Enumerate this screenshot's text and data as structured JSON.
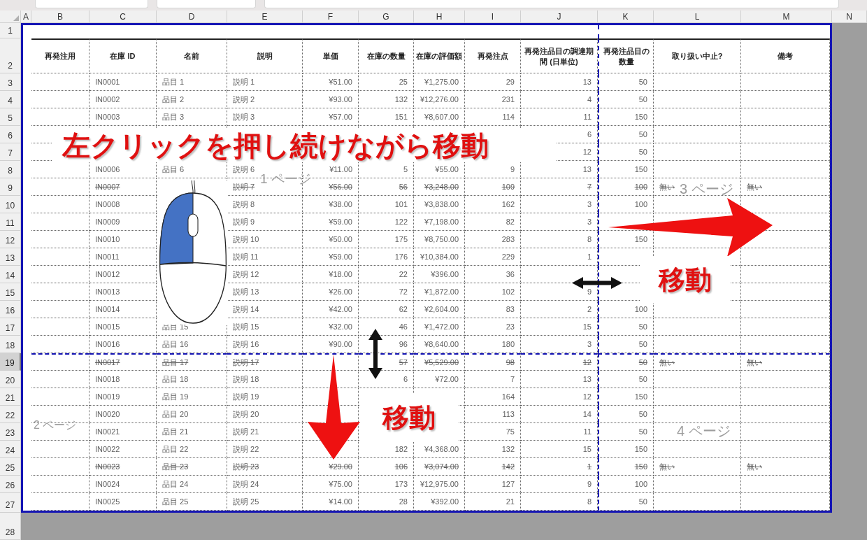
{
  "column_headers": [
    "A",
    "B",
    "C",
    "D",
    "E",
    "F",
    "G",
    "H",
    "I",
    "J",
    "K",
    "L",
    "M",
    "N"
  ],
  "row_numbers": [
    {
      "label": "1",
      "selected": false
    },
    {
      "label": "2",
      "selected": false
    },
    {
      "label": "3",
      "selected": false
    },
    {
      "label": "4",
      "selected": false
    },
    {
      "label": "5",
      "selected": false
    },
    {
      "label": "6",
      "selected": false
    },
    {
      "label": "7",
      "selected": false
    },
    {
      "label": "8",
      "selected": false
    },
    {
      "label": "9",
      "selected": false
    },
    {
      "label": "10",
      "selected": false
    },
    {
      "label": "11",
      "selected": false
    },
    {
      "label": "12",
      "selected": false
    },
    {
      "label": "13",
      "selected": false
    },
    {
      "label": "14",
      "selected": false
    },
    {
      "label": "15",
      "selected": false
    },
    {
      "label": "16",
      "selected": false
    },
    {
      "label": "17",
      "selected": false
    },
    {
      "label": "18",
      "selected": false
    },
    {
      "label": "19",
      "selected": true
    },
    {
      "label": "20",
      "selected": false
    },
    {
      "label": "21",
      "selected": false
    },
    {
      "label": "22",
      "selected": false
    },
    {
      "label": "23",
      "selected": false
    },
    {
      "label": "24",
      "selected": false
    },
    {
      "label": "25",
      "selected": false
    },
    {
      "label": "26",
      "selected": false
    },
    {
      "label": "27",
      "selected": false
    },
    {
      "label": "28",
      "selected": false
    }
  ],
  "table": {
    "columns": [
      "再発注用",
      "在庫 ID",
      "名前",
      "説明",
      "単価",
      "在庫の数量",
      "在庫の評価額",
      "再発注点",
      "再発注品目の調達期間 (日単位)",
      "再発注品目の数量",
      "取り扱い中止?",
      "備考"
    ],
    "rows": [
      {
        "discontinued": false,
        "cells": [
          null,
          "IN0001",
          "品目 1",
          "説明 1",
          "¥51.00",
          "25",
          "¥1,275.00",
          "29",
          "13",
          "50",
          null,
          null
        ]
      },
      {
        "discontinued": false,
        "cells": [
          null,
          "IN0002",
          "品目 2",
          "説明 2",
          "¥93.00",
          "132",
          "¥12,276.00",
          "231",
          "4",
          "50",
          null,
          null
        ]
      },
      {
        "discontinued": false,
        "cells": [
          null,
          "IN0003",
          "品目 3",
          "説明 3",
          "¥57.00",
          "151",
          "¥8,607.00",
          "114",
          "11",
          "150",
          null,
          null
        ]
      },
      {
        "discontinued": false,
        "cells": [
          null,
          null,
          null,
          null,
          null,
          null,
          null,
          null,
          "6",
          "50",
          null,
          null
        ]
      },
      {
        "discontinued": false,
        "cells": [
          null,
          null,
          null,
          null,
          null,
          null,
          null,
          null,
          "12",
          "50",
          null,
          null
        ]
      },
      {
        "discontinued": false,
        "cells": [
          null,
          "IN0006",
          "品目 6",
          "説明 6",
          "¥11.00",
          "5",
          "¥55.00",
          "9",
          "13",
          "150",
          null,
          null
        ]
      },
      {
        "discontinued": true,
        "cells": [
          null,
          "IN0007",
          null,
          "説明 7",
          "¥56.00",
          "56",
          "¥3,248.00",
          "109",
          "7",
          "100",
          "無い",
          "無い"
        ]
      },
      {
        "discontinued": false,
        "cells": [
          null,
          "IN0008",
          null,
          "説明 8",
          "¥38.00",
          "101",
          "¥3,838.00",
          "162",
          "3",
          "100",
          null,
          null
        ]
      },
      {
        "discontinued": false,
        "cells": [
          null,
          "IN0009",
          null,
          "説明 9",
          "¥59.00",
          "122",
          "¥7,198.00",
          "82",
          "3",
          null,
          null,
          null
        ]
      },
      {
        "discontinued": false,
        "cells": [
          null,
          "IN0010",
          null,
          "説明 10",
          "¥50.00",
          "175",
          "¥8,750.00",
          "283",
          "8",
          "150",
          null,
          null
        ]
      },
      {
        "discontinued": false,
        "cells": [
          null,
          "IN0011",
          null,
          "説明 11",
          "¥59.00",
          "176",
          "¥10,384.00",
          "229",
          "1",
          null,
          null,
          null
        ]
      },
      {
        "discontinued": false,
        "cells": [
          null,
          "IN0012",
          null,
          "説明 12",
          "¥18.00",
          "22",
          "¥396.00",
          "36",
          null,
          null,
          null,
          null
        ]
      },
      {
        "discontinued": false,
        "cells": [
          null,
          "IN0013",
          null,
          "説明 13",
          "¥26.00",
          "72",
          "¥1,872.00",
          "102",
          "9",
          null,
          null,
          null
        ]
      },
      {
        "discontinued": false,
        "cells": [
          null,
          "IN0014",
          null,
          "説明 14",
          "¥42.00",
          "62",
          "¥2,604.00",
          "83",
          "2",
          "100",
          null,
          null
        ]
      },
      {
        "discontinued": false,
        "cells": [
          null,
          "IN0015",
          "品目 15",
          "説明 15",
          "¥32.00",
          "46",
          "¥1,472.00",
          "23",
          "15",
          "50",
          null,
          null
        ]
      },
      {
        "discontinued": false,
        "cells": [
          null,
          "IN0016",
          "品目 16",
          "説明 16",
          "¥90.00",
          "96",
          "¥8,640.00",
          "180",
          "3",
          "50",
          null,
          null
        ]
      },
      {
        "discontinued": true,
        "cells": [
          null,
          "IN0017",
          "品目 17",
          "説明 17",
          null,
          "57",
          "¥5,529.00",
          "98",
          "12",
          "50",
          "無い",
          "無い"
        ]
      },
      {
        "discontinued": false,
        "cells": [
          null,
          "IN0018",
          "品目 18",
          "説明 18",
          null,
          "6",
          "¥72.00",
          "7",
          "13",
          "50",
          null,
          null
        ]
      },
      {
        "discontinued": false,
        "cells": [
          null,
          "IN0019",
          "品目 19",
          "説明 19",
          null,
          null,
          null,
          "164",
          "12",
          "150",
          null,
          null
        ]
      },
      {
        "discontinued": false,
        "cells": [
          null,
          "IN0020",
          "品目 20",
          "説明 20",
          null,
          null,
          null,
          "113",
          "14",
          "50",
          null,
          null
        ]
      },
      {
        "discontinued": false,
        "cells": [
          null,
          "IN0021",
          "品目 21",
          "説明 21",
          null,
          null,
          null,
          "75",
          "11",
          "50",
          null,
          null
        ]
      },
      {
        "discontinued": false,
        "cells": [
          null,
          "IN0022",
          "品目 22",
          "説明 22",
          null,
          "182",
          "¥4,368.00",
          "132",
          "15",
          "150",
          null,
          null
        ]
      },
      {
        "discontinued": true,
        "cells": [
          null,
          "IN0023",
          "品目 23",
          "説明 23",
          "¥29.00",
          "106",
          "¥3,074.00",
          "142",
          "1",
          "150",
          "無い",
          "無い"
        ]
      },
      {
        "discontinued": false,
        "cells": [
          null,
          "IN0024",
          "品目 24",
          "説明 24",
          "¥75.00",
          "173",
          "¥12,975.00",
          "127",
          "9",
          "100",
          null,
          null
        ]
      },
      {
        "discontinued": false,
        "cells": [
          null,
          "IN0025",
          "品目 25",
          "説明 25",
          "¥14.00",
          "28",
          "¥392.00",
          "21",
          "8",
          "50",
          null,
          null
        ]
      }
    ]
  },
  "page_labels": [
    "1 ページ",
    "3 ページ",
    "2 ページ",
    "4 ページ"
  ],
  "callout": "左クリックを押し続けながら移動",
  "move_labels": [
    "移動",
    "移動"
  ]
}
